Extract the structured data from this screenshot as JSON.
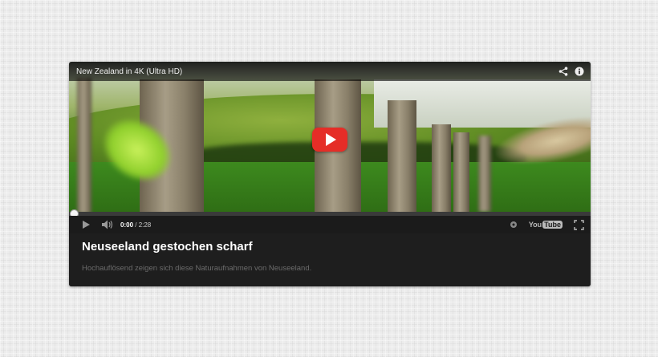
{
  "video": {
    "title": "New Zealand in 4K (Ultra HD)",
    "icons": {
      "share": "share-icon",
      "info": "info-icon",
      "play": "play-icon"
    },
    "accent_color": "#e52d27"
  },
  "controls": {
    "current_time": "0:00",
    "separator": " / ",
    "duration": "2:28",
    "progress": 0,
    "youtube_logo": {
      "you": "You",
      "tube": "Tube"
    },
    "icons": [
      "play-icon",
      "volume-icon",
      "gear-icon",
      "youtube-logo",
      "fullscreen-icon"
    ]
  },
  "card": {
    "headline": "Neuseeland gestochen scharf",
    "description": "Hochauflösend zeigen sich diese Naturaufnahmen von Neuseeland."
  }
}
